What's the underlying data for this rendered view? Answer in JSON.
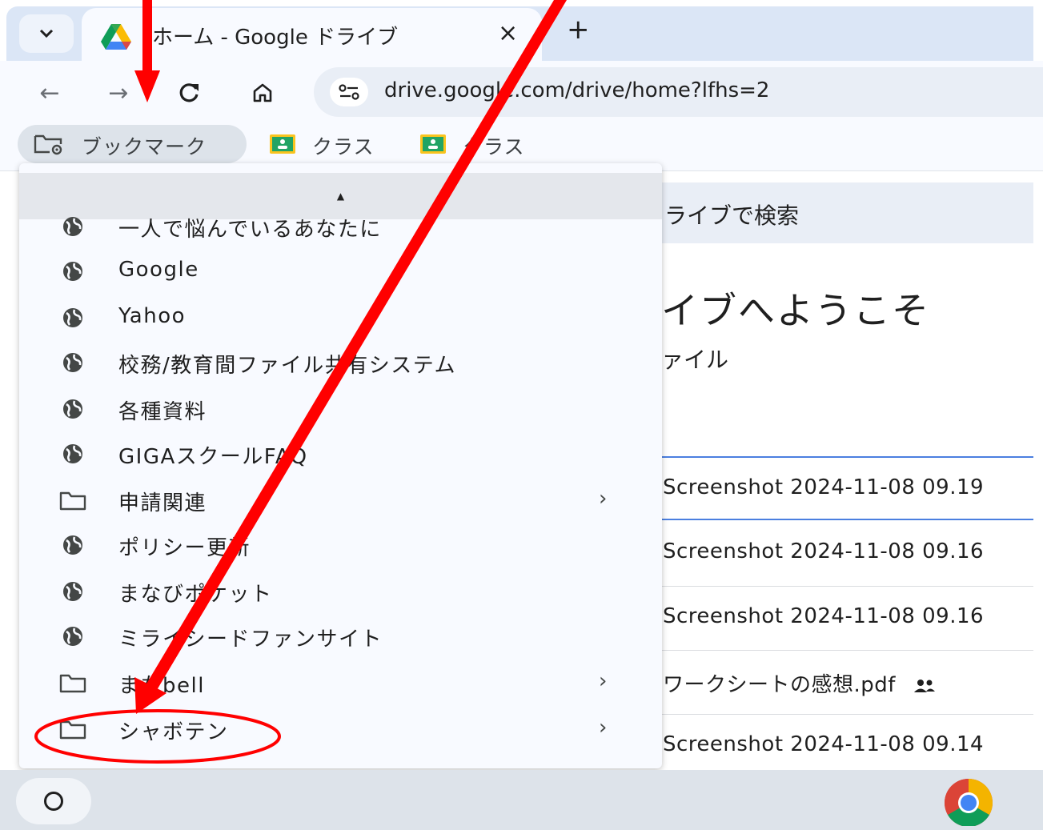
{
  "tabs": {
    "search_tabs_icon": "chevron-down",
    "active": {
      "title": "ホーム - Google ドライブ",
      "close": "×",
      "favicon": "google-drive-icon"
    },
    "new_tab": "+"
  },
  "toolbar": {
    "back": "←",
    "forward": "→",
    "reload": "C",
    "home": "home-icon",
    "url": "drive.google.com/drive/home?lfhs=2"
  },
  "bookmarks_bar": {
    "all_bookmarks": "ブックマーク",
    "items": [
      {
        "label": "クラス",
        "icon": "google-classroom-icon"
      },
      {
        "label": "クラス",
        "icon": "google-classroom-icon"
      }
    ]
  },
  "bookmark_menu": {
    "scroll_up": "▲",
    "items": [
      {
        "label": "一人で悩んでいるあなたに",
        "type": "site"
      },
      {
        "label": "Google",
        "type": "site"
      },
      {
        "label": "Yahoo",
        "type": "site"
      },
      {
        "label": "校務/教育間ファイル共有システム",
        "type": "site"
      },
      {
        "label": "各種資料",
        "type": "site"
      },
      {
        "label": "GIGAスクールFAQ",
        "type": "site"
      },
      {
        "label": "申請関連",
        "type": "folder",
        "chevron": "›"
      },
      {
        "label": "ポリシー更新",
        "type": "site"
      },
      {
        "label": "まなびポケット",
        "type": "site"
      },
      {
        "label": "ミライシードファンサイト",
        "type": "site"
      },
      {
        "label": "まなbell",
        "type": "folder",
        "chevron": "›"
      },
      {
        "label": "シャボテン",
        "type": "folder",
        "chevron": "›"
      }
    ]
  },
  "drive": {
    "search_placeholder": "ライブで検索",
    "welcome": "イブへようこそ",
    "subtitle": "ァイル",
    "files": [
      {
        "name": "Screenshot 2024-11-08 09.19"
      },
      {
        "name": "Screenshot 2024-11-08 09.16"
      },
      {
        "name": "Screenshot 2024-11-08 09.16"
      },
      {
        "name": "ワークシートの感想.pdf",
        "shared": true
      },
      {
        "name": "Screenshot 2024-11-08 09.14"
      }
    ]
  },
  "shelf": {
    "launcher": "launcher-icon",
    "pinned": [
      "chrome-icon"
    ]
  },
  "annotation": {
    "color": "#ff0000"
  }
}
